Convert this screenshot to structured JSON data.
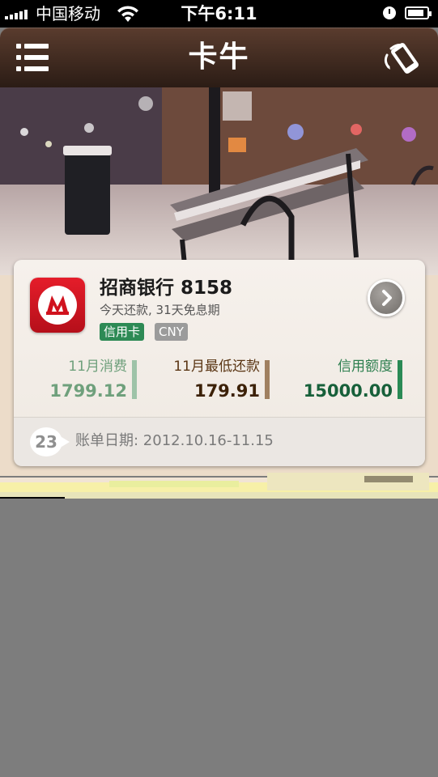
{
  "status_bar": {
    "carrier": "中国移动",
    "time": "下午6:11",
    "signal_bars": 5,
    "battery_level": 0.85,
    "icons": [
      "signal-icon",
      "wifi-icon",
      "clock-icon",
      "battery-icon"
    ]
  },
  "nav": {
    "title": "卡牛",
    "left_icon": "menu-icon",
    "right_icon": "shake-icon"
  },
  "card": {
    "bank_name": "招商银行 8158",
    "bank_logo_icon": "cmb-logo-icon",
    "subtitle": "今天还款, 31天免息期",
    "tags": [
      {
        "label": "信用卡",
        "color": "#2d8a55"
      },
      {
        "label": "CNY",
        "color": "#9b9b9b"
      }
    ],
    "stats": [
      {
        "label": "11月消费",
        "value": "1799.12",
        "color": "#6fa07c"
      },
      {
        "label": "11月最低还款",
        "value": "179.91",
        "color": "#3c2108"
      },
      {
        "label": "信用额度",
        "value": "15000.00",
        "color": "#17603a"
      }
    ],
    "bill_day": "23",
    "bill_period": "账单日期: 2012.10.16-11.15",
    "detail_icon": "chevron-right-icon"
  },
  "colors": {
    "nav_bg": "#3e2a20",
    "card_bg": "#f4efe9",
    "empty_area": "#7d7d7d"
  }
}
